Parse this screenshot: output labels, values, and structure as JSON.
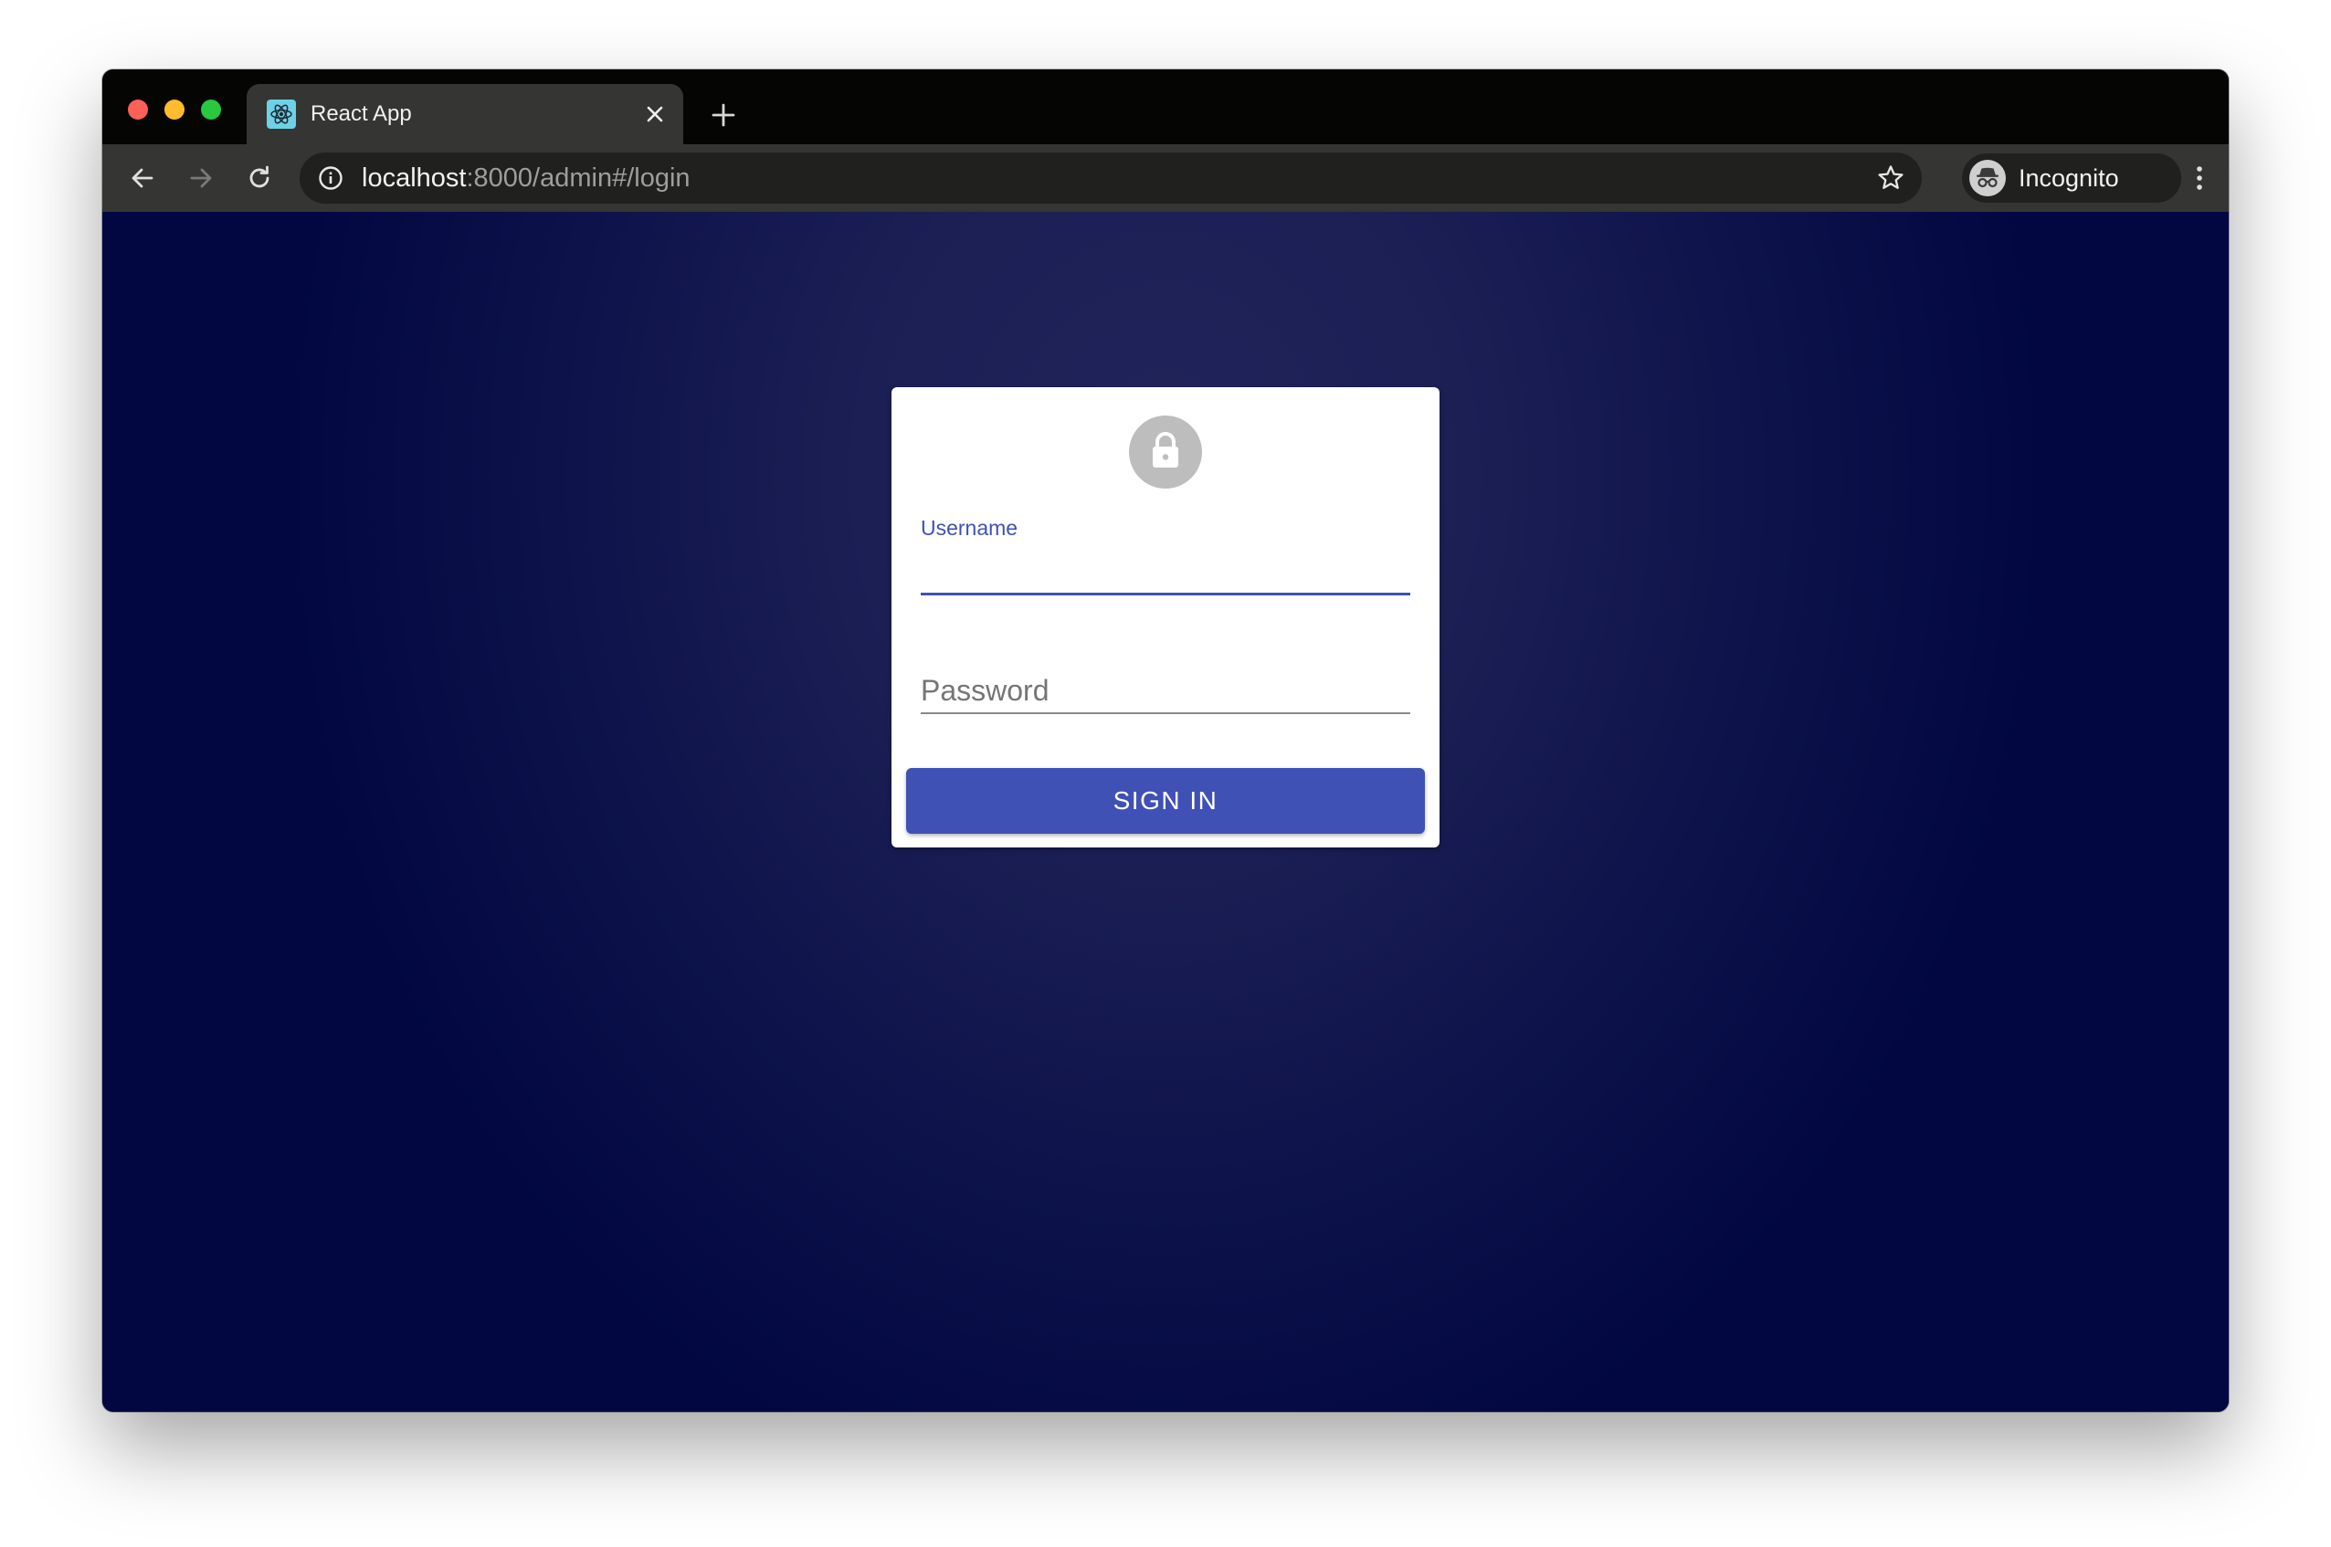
{
  "browser": {
    "tab": {
      "title": "React App",
      "favicon": "react-logo-icon"
    },
    "url": {
      "host": "localhost",
      "path": ":8000/admin#/login"
    },
    "profile": {
      "label": "Incognito",
      "icon": "incognito-icon"
    },
    "icons": {
      "back": "arrow-left-icon",
      "forward": "arrow-right-icon",
      "reload": "reload-icon",
      "info": "info-icon",
      "bookmark": "star-icon",
      "menu": "more-vertical-icon",
      "close_tab": "close-icon",
      "new_tab": "plus-icon"
    }
  },
  "login": {
    "avatar_icon": "lock-icon",
    "username": {
      "label": "Username",
      "value": ""
    },
    "password": {
      "placeholder": "Password",
      "value": ""
    },
    "submit_label": "SIGN IN"
  },
  "colors": {
    "primary": "#3f51b5",
    "background_center": "#20245a",
    "background_edge": "#020742",
    "avatar": "#bdbdbd"
  }
}
